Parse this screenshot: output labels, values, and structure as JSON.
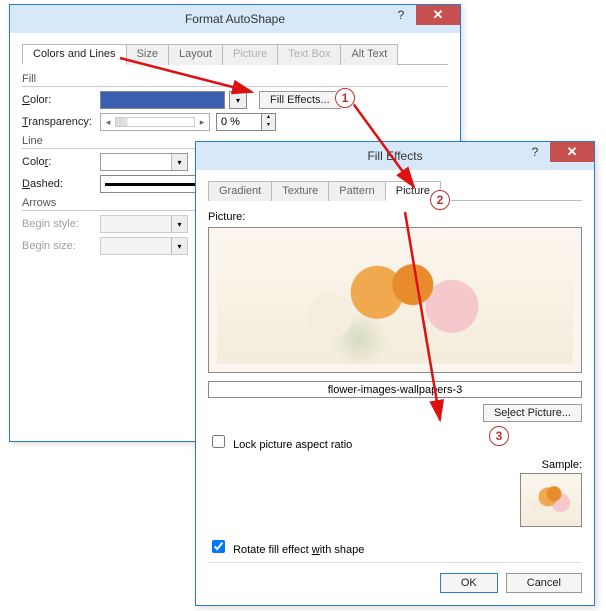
{
  "format_autoshape": {
    "title": "Format AutoShape",
    "tabs": [
      "Colors and Lines",
      "Size",
      "Layout",
      "Picture",
      "Text Box",
      "Alt Text"
    ],
    "active_tab": 0,
    "disabled_tabs": [
      3,
      4
    ],
    "fill": {
      "section": "Fill",
      "color_label": "Color:",
      "color_value": "#3b5fb0",
      "fill_effects_btn": "Fill Effects...",
      "transparency_label": "Transparency:",
      "transparency_value": "0 %"
    },
    "line": {
      "section": "Line",
      "color_label": "Color:",
      "dashed_label": "Dashed:"
    },
    "arrows": {
      "section": "Arrows",
      "begin_style": "Begin style:",
      "begin_size": "Begin size:"
    }
  },
  "fill_effects": {
    "title": "Fill Effects",
    "tabs": [
      "Gradient",
      "Texture",
      "Pattern",
      "Picture"
    ],
    "active_tab": 3,
    "picture_label": "Picture:",
    "picture_name": "flower-images-wallpapers-3",
    "select_btn": "Select Picture...",
    "lock_aspect": "Lock picture aspect ratio",
    "lock_aspect_checked": false,
    "rotate": "Rotate fill effect with shape",
    "rotate_checked": true,
    "sample_label": "Sample:",
    "ok": "OK",
    "cancel": "Cancel"
  },
  "callouts": {
    "one": "1",
    "two": "2",
    "three": "3"
  }
}
